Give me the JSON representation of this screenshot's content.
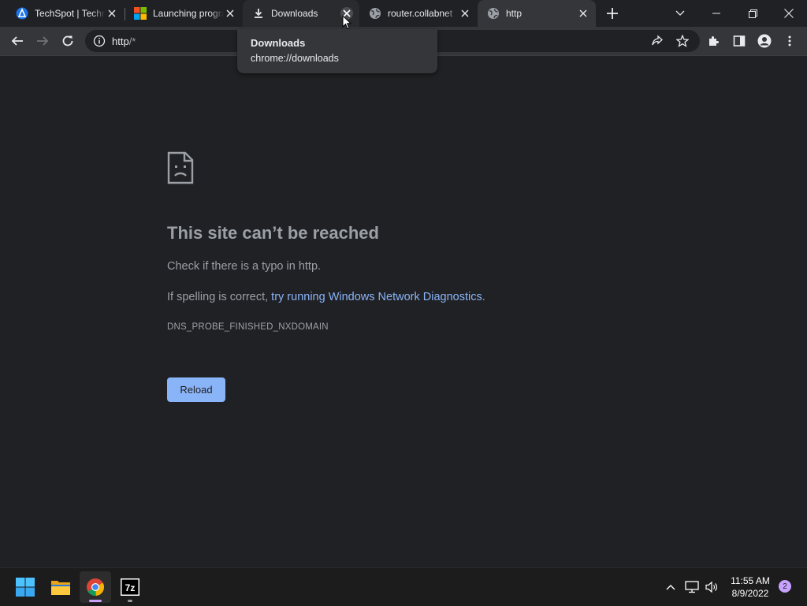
{
  "tabs": [
    {
      "title": "TechSpot | Technology News",
      "favicon": "techspot-icon",
      "close": "close-icon"
    },
    {
      "title": "Launching programs",
      "favicon": "microsoft-icon",
      "close": "close-icon"
    },
    {
      "title": "Downloads",
      "favicon": "download-icon",
      "close": "close-icon"
    },
    {
      "title": "router.collabnet",
      "favicon": "globe-icon",
      "close": "close-icon"
    },
    {
      "title": "http",
      "favicon": "globe-icon",
      "close": "close-icon"
    }
  ],
  "tooltip": {
    "title": "Downloads",
    "subtitle": "chrome://downloads"
  },
  "omnibox": {
    "url_main": "http",
    "url_dim": "/*"
  },
  "error": {
    "title": "This site can’t be reached",
    "line1": "Check if there is a typo in http.",
    "line2_prefix": "If spelling is correct, ",
    "line2_link": "try running Windows Network Diagnostics",
    "line2_suffix": ".",
    "code": "DNS_PROBE_FINISHED_NXDOMAIN",
    "reload_label": "Reload"
  },
  "taskbar": {
    "time": "11:55 AM",
    "date": "8/9/2022",
    "badge": "2"
  },
  "colors": {
    "accent_link": "#8ab4f8",
    "background": "#202124",
    "toolbar": "#35363a"
  }
}
